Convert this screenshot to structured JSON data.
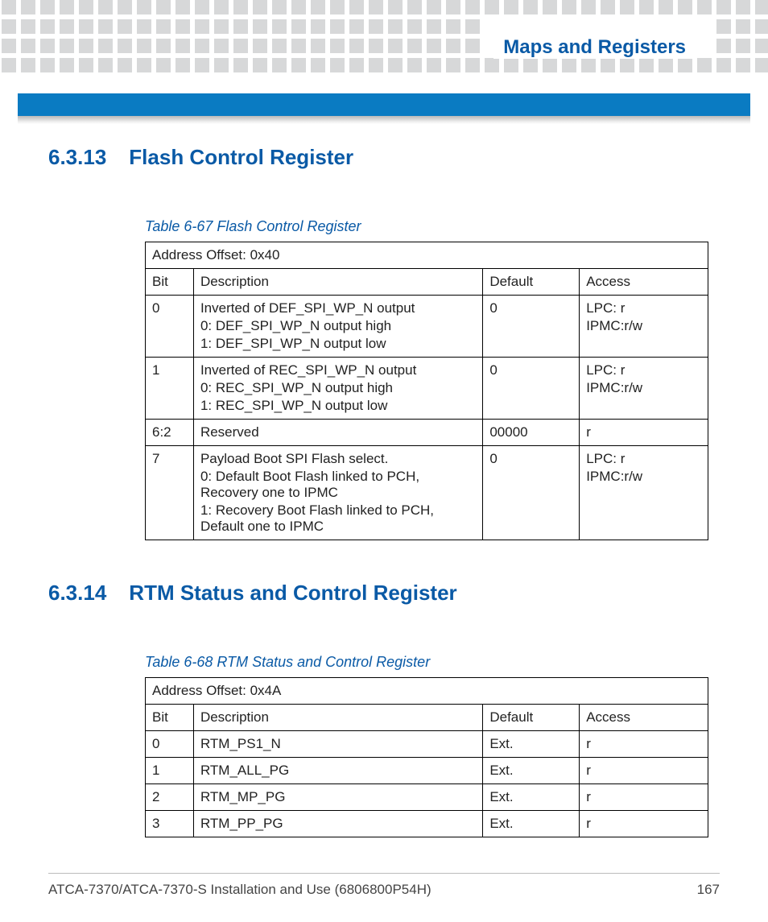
{
  "chapter_title": "Maps and Registers",
  "sections": [
    {
      "number": "6.3.13",
      "title": "Flash Control Register",
      "table_caption": "Table 6-67 Flash Control Register",
      "address_offset": "Address Offset: 0x40",
      "headers": {
        "bit": "Bit",
        "desc": "Description",
        "def": "Default",
        "acc": "Access"
      },
      "rows": [
        {
          "bit": "0",
          "desc_main": "Inverted of DEF_SPI_WP_N output",
          "desc_sub1": "0: DEF_SPI_WP_N output high",
          "desc_sub2": "1: DEF_SPI_WP_N output low",
          "def": "0",
          "acc_line1": "LPC: r",
          "acc_line2": "IPMC:r/w"
        },
        {
          "bit": "1",
          "desc_main": "Inverted of REC_SPI_WP_N output",
          "desc_sub1": "0: REC_SPI_WP_N output high",
          "desc_sub2": "1: REC_SPI_WP_N output low",
          "def": "0",
          "acc_line1": "LPC: r",
          "acc_line2": "IPMC:r/w"
        },
        {
          "bit": "6:2",
          "desc_main": "Reserved",
          "desc_sub1": "",
          "desc_sub2": "",
          "def": "00000",
          "acc_line1": "r",
          "acc_line2": ""
        },
        {
          "bit": "7",
          "desc_main": "Payload Boot SPI Flash select.",
          "desc_sub1": "0: Default Boot Flash linked to PCH, Recovery one to IPMC",
          "desc_sub2": "1: Recovery Boot Flash linked to PCH, Default one to IPMC",
          "def": "0",
          "acc_line1": "LPC: r",
          "acc_line2": "IPMC:r/w"
        }
      ]
    },
    {
      "number": "6.3.14",
      "title": "RTM Status and Control Register",
      "table_caption": "Table 6-68 RTM Status and Control Register",
      "address_offset": "Address Offset: 0x4A",
      "headers": {
        "bit": "Bit",
        "desc": "Description",
        "def": "Default",
        "acc": "Access"
      },
      "rows": [
        {
          "bit": "0",
          "desc_main": "RTM_PS1_N",
          "desc_sub1": "",
          "desc_sub2": "",
          "def": "Ext.",
          "acc_line1": "r",
          "acc_line2": ""
        },
        {
          "bit": "1",
          "desc_main": "RTM_ALL_PG",
          "desc_sub1": "",
          "desc_sub2": "",
          "def": "Ext.",
          "acc_line1": "r",
          "acc_line2": ""
        },
        {
          "bit": "2",
          "desc_main": "RTM_MP_PG",
          "desc_sub1": "",
          "desc_sub2": "",
          "def": "Ext.",
          "acc_line1": "r",
          "acc_line2": ""
        },
        {
          "bit": "3",
          "desc_main": "RTM_PP_PG",
          "desc_sub1": "",
          "desc_sub2": "",
          "def": "Ext.",
          "acc_line1": "r",
          "acc_line2": ""
        }
      ]
    }
  ],
  "footer_left": "ATCA-7370/ATCA-7370-S Installation and Use (6806800P54H)",
  "footer_right": "167"
}
